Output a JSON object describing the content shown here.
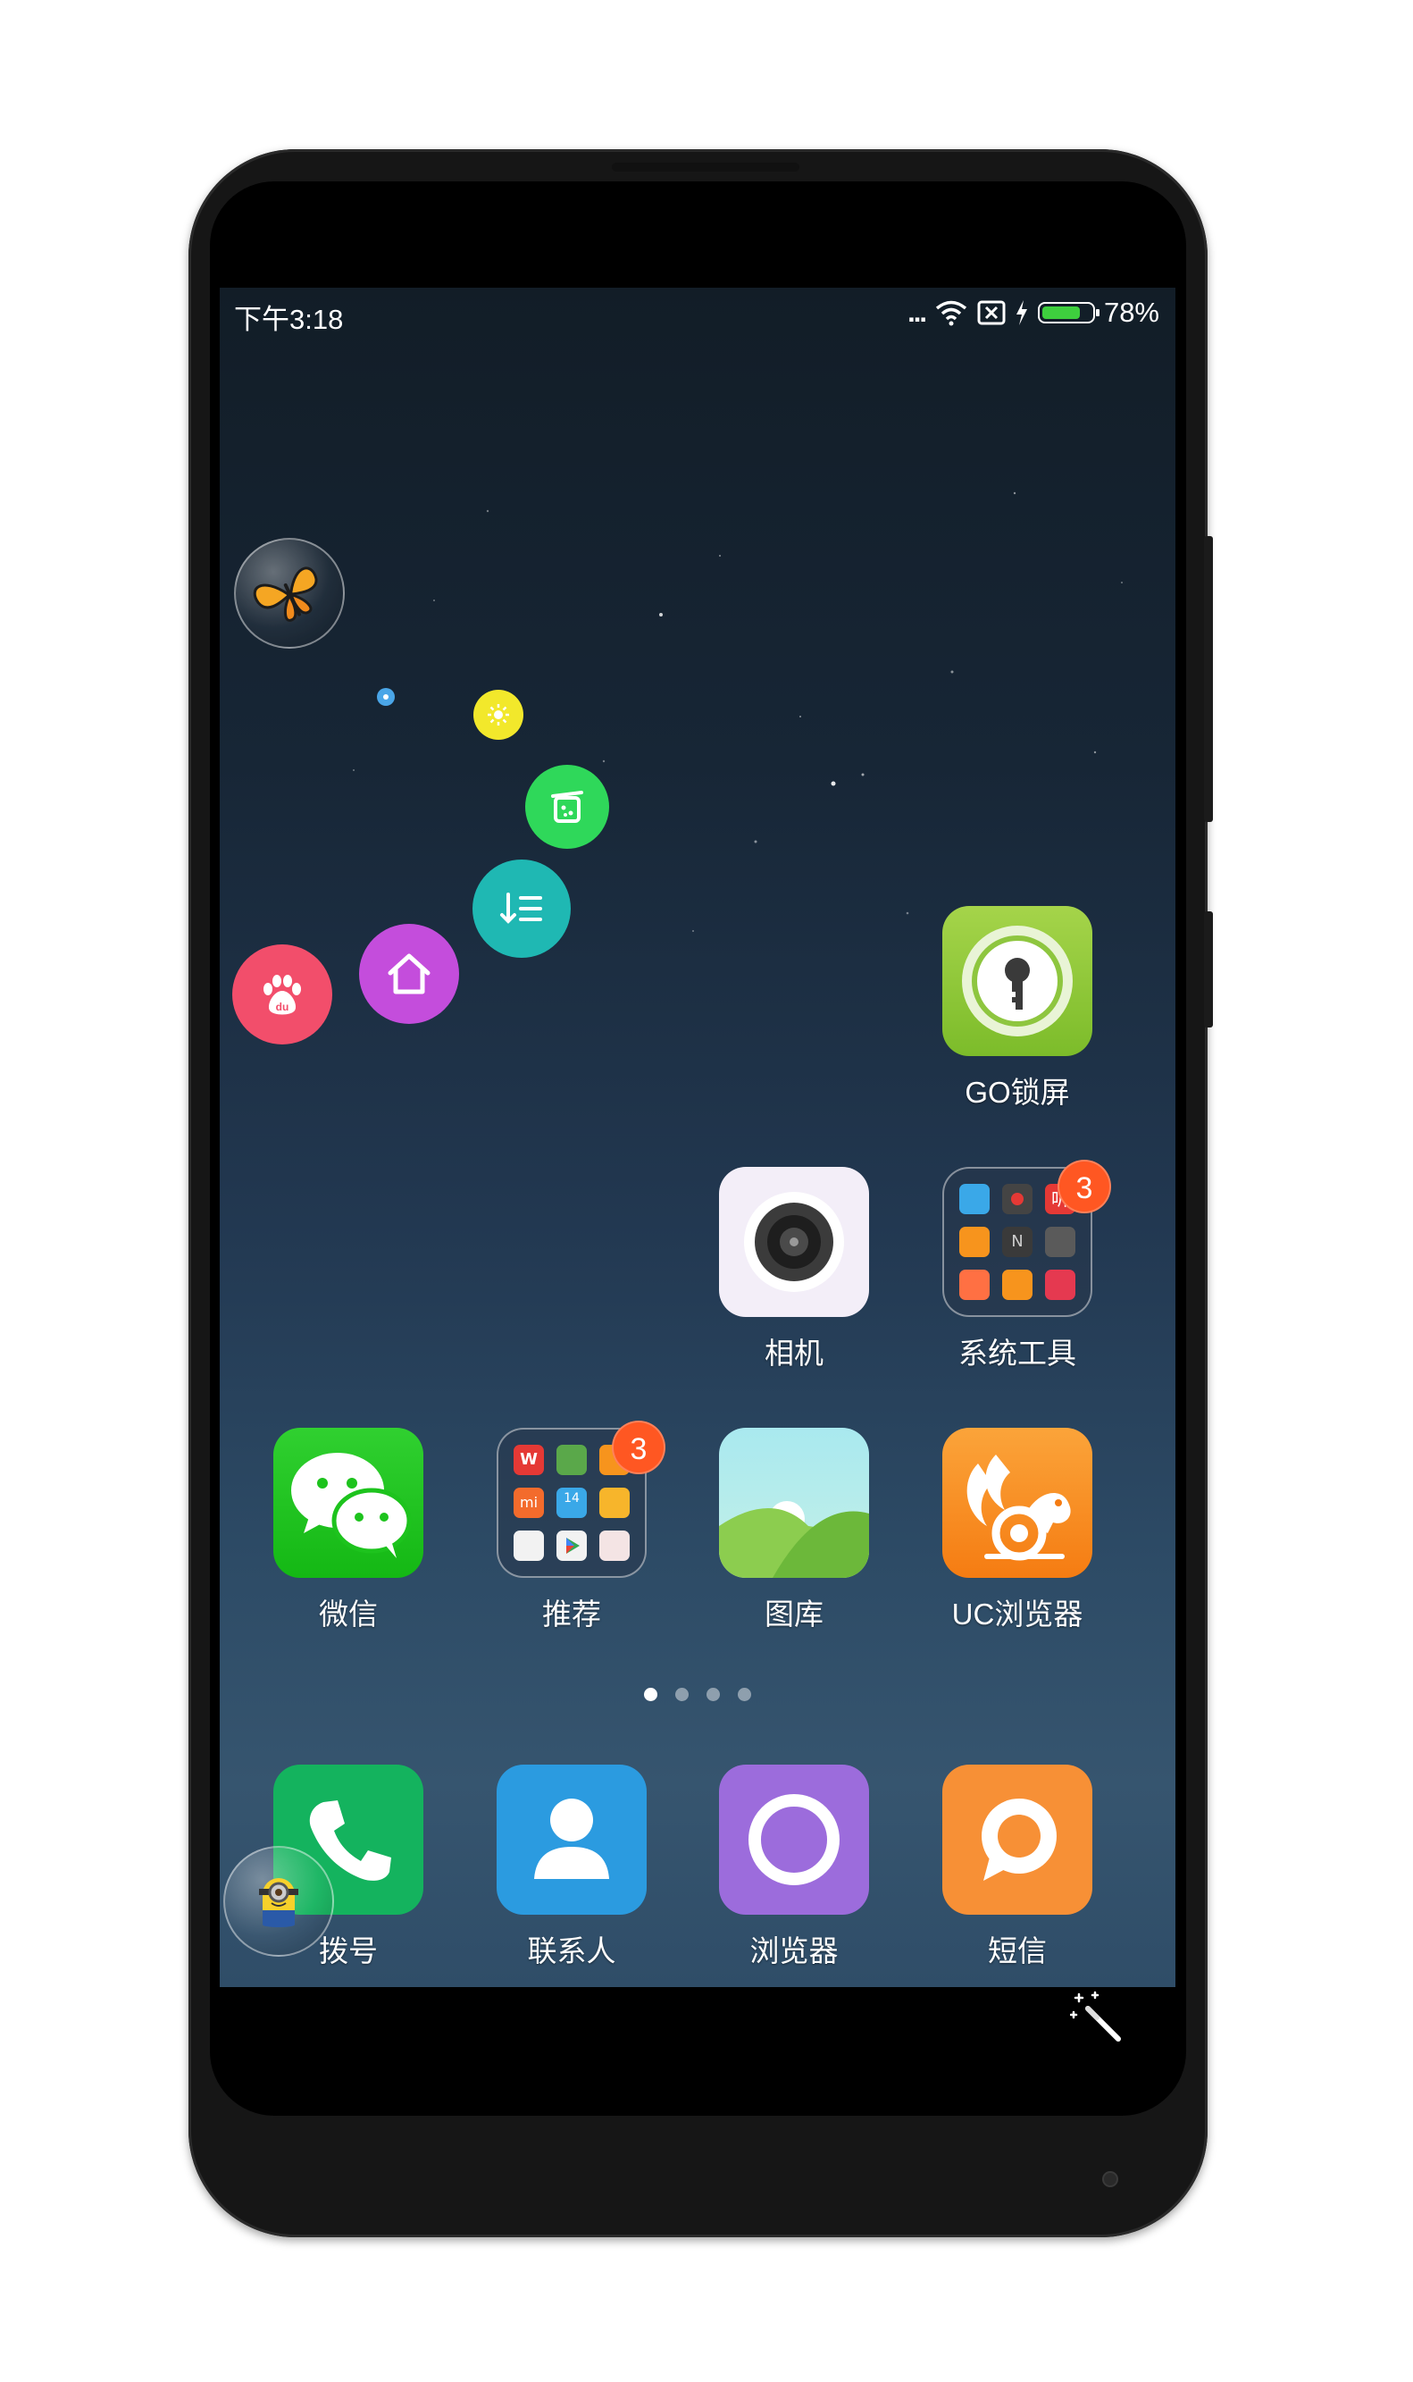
{
  "status_bar": {
    "time": "下午3:18",
    "more": "...",
    "battery_percent": "78%",
    "battery_level": 0.78,
    "icons": [
      "wifi-icon",
      "no-sim-icon",
      "charging-icon",
      "battery-icon"
    ]
  },
  "floating_menu": {
    "items": [
      "baidu-icon",
      "home-icon",
      "list-icon",
      "cleaner-icon",
      "brightness-icon",
      "small-dot-icon"
    ]
  },
  "apps": {
    "go_lock": {
      "label": "GO锁屏"
    },
    "camera": {
      "label": "相机"
    },
    "system_tools": {
      "label": "系统工具",
      "badge": "3",
      "mini_labels": [
        "N",
        "听"
      ]
    },
    "wechat": {
      "label": "微信"
    },
    "recommend": {
      "label": "推荐",
      "badge": "3",
      "mini_labels": [
        "W",
        "mi",
        "14"
      ]
    },
    "gallery": {
      "label": "图库"
    },
    "uc_browser": {
      "label": "UC浏览器"
    }
  },
  "page_indicator": {
    "pages": 4,
    "current": 1
  },
  "dock": {
    "phone": {
      "label": "拨号"
    },
    "contacts": {
      "label": "联系人"
    },
    "browser": {
      "label": "浏览器"
    },
    "messages": {
      "label": "短信"
    }
  },
  "colors": {
    "wechat": "#1dc31d",
    "phone": "#14b35e",
    "contacts": "#2b9be0",
    "browser": "#9c6cdc",
    "messages": "#f79036",
    "uc": "#f7941d",
    "go_lock": "#8ec63f",
    "badge": "#ff5722"
  }
}
